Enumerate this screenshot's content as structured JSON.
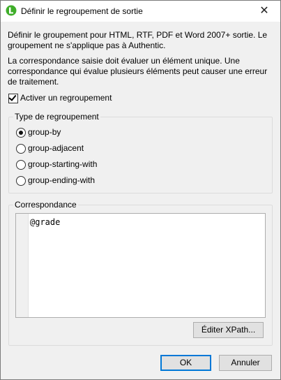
{
  "window": {
    "title": "Définir le regroupement de sortie",
    "close_glyph": "✕"
  },
  "intro": {
    "paragraph1": "Définir le groupement pour HTML, RTF, PDF et Word 2007+ sortie. Le groupement ne s'applique pas à Authentic.",
    "paragraph2": "La correspondance saisie doit évaluer un élément unique. Une correspondance qui évalue plusieurs éléments peut causer une erreur de traitement."
  },
  "enable_grouping": {
    "label": "Activer un regroupement",
    "checked": true
  },
  "grouping_type": {
    "legend": "Type de regroupement",
    "options": [
      {
        "label": "group-by",
        "selected": true
      },
      {
        "label": "group-adjacent",
        "selected": false
      },
      {
        "label": "group-starting-with",
        "selected": false
      },
      {
        "label": "group-ending-with",
        "selected": false
      }
    ]
  },
  "match": {
    "legend": "Correspondance",
    "value": "@grade",
    "edit_xpath_label": "Éditer XPath..."
  },
  "footer": {
    "ok_label": "OK",
    "cancel_label": "Annuler"
  },
  "colors": {
    "app_icon": "#3fae2a",
    "default_button_border": "#0078d7",
    "dialog_background": "#f0f0f0"
  }
}
